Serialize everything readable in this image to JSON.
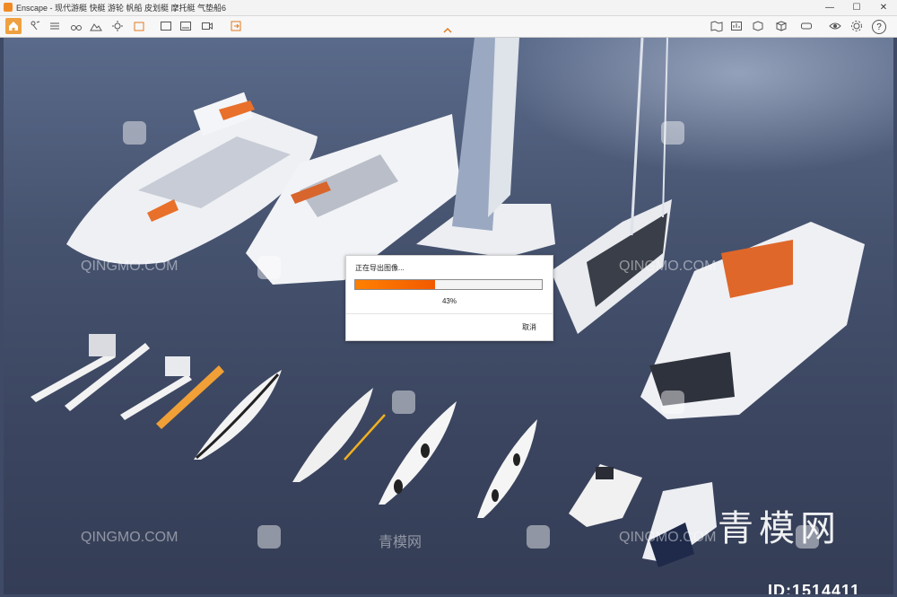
{
  "window": {
    "title": "Enscape - 现代游艇 快艇 游轮 帆船 皮划艇 摩托艇 气垫船6",
    "controls": {
      "minimize": "—",
      "maximize": "☐",
      "close": "✕"
    }
  },
  "toolbar": {
    "left_tools": [
      "home-icon",
      "walk-icon",
      "settings-lines-icon",
      "binoculars-icon",
      "mountain-icon",
      "sun-icon",
      "package-icon",
      "screenshot-icon",
      "panorama-icon",
      "video-icon",
      "export-icon"
    ],
    "right_tools": [
      "map-icon",
      "stats-icon",
      "box-icon",
      "cube-icon",
      "vr-icon",
      "eye-icon",
      "settings-icon",
      "help-icon"
    ],
    "help_label": "?"
  },
  "dialog": {
    "title": "正在导出图像...",
    "progress_percent": 43,
    "progress_label": "43%",
    "cancel_label": "取消"
  },
  "watermarks": {
    "site_text": "QINGMO.COM",
    "site_cn": "青模网",
    "brand": "青模网",
    "id_label": "ID:1514411"
  },
  "colors": {
    "accent": "#f08a24",
    "progress": "#ff7a00",
    "water": "#3f4a66"
  }
}
